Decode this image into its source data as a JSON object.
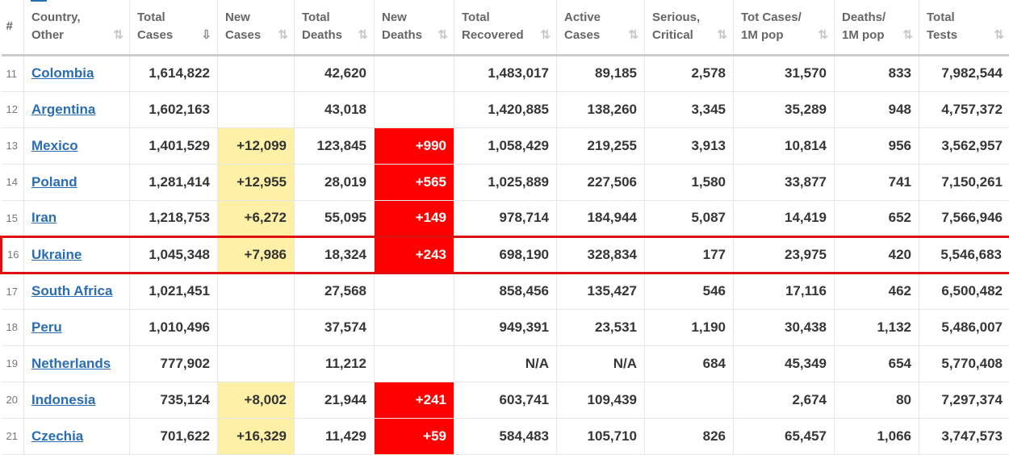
{
  "columns": [
    {
      "key": "idx",
      "label": "#",
      "sortable": false
    },
    {
      "key": "country",
      "label": "Country, Other",
      "sortable": true
    },
    {
      "key": "total_cases",
      "label": "Total Cases",
      "sortable": true,
      "active": true
    },
    {
      "key": "new_cases",
      "label": "New Cases",
      "sortable": true
    },
    {
      "key": "total_deaths",
      "label": "Total Deaths",
      "sortable": true
    },
    {
      "key": "new_deaths",
      "label": "New Deaths",
      "sortable": true
    },
    {
      "key": "total_recovered",
      "label": "Total Recovered",
      "sortable": true
    },
    {
      "key": "active_cases",
      "label": "Active Cases",
      "sortable": true
    },
    {
      "key": "serious",
      "label": "Serious, Critical",
      "sortable": true
    },
    {
      "key": "cases_per_m",
      "label": "Tot Cases/ 1M pop",
      "sortable": true
    },
    {
      "key": "deaths_per_m",
      "label": "Deaths/ 1M pop",
      "sortable": true
    },
    {
      "key": "total_tests",
      "label": "Total Tests",
      "sortable": true
    }
  ],
  "sort_icon": "⇅",
  "sort_icon_active": "⇩",
  "colors": {
    "new_cases_bg": "#fff0a8",
    "new_deaths_bg": "#ff0000",
    "highlight_border": "#e01010",
    "link": "#2a6db5"
  },
  "highlighted_country": "Ukraine",
  "rows": [
    {
      "idx": "11",
      "country": "Colombia",
      "total_cases": "1,614,822",
      "new_cases": "",
      "total_deaths": "42,620",
      "new_deaths": "",
      "total_recovered": "1,483,017",
      "active_cases": "89,185",
      "serious": "2,578",
      "cases_per_m": "31,570",
      "deaths_per_m": "833",
      "total_tests": "7,982,544"
    },
    {
      "idx": "12",
      "country": "Argentina",
      "total_cases": "1,602,163",
      "new_cases": "",
      "total_deaths": "43,018",
      "new_deaths": "",
      "total_recovered": "1,420,885",
      "active_cases": "138,260",
      "serious": "3,345",
      "cases_per_m": "35,289",
      "deaths_per_m": "948",
      "total_tests": "4,757,372"
    },
    {
      "idx": "13",
      "country": "Mexico",
      "total_cases": "1,401,529",
      "new_cases": "+12,099",
      "total_deaths": "123,845",
      "new_deaths": "+990",
      "total_recovered": "1,058,429",
      "active_cases": "219,255",
      "serious": "3,913",
      "cases_per_m": "10,814",
      "deaths_per_m": "956",
      "total_tests": "3,562,957"
    },
    {
      "idx": "14",
      "country": "Poland",
      "total_cases": "1,281,414",
      "new_cases": "+12,955",
      "total_deaths": "28,019",
      "new_deaths": "+565",
      "total_recovered": "1,025,889",
      "active_cases": "227,506",
      "serious": "1,580",
      "cases_per_m": "33,877",
      "deaths_per_m": "741",
      "total_tests": "7,150,261"
    },
    {
      "idx": "15",
      "country": "Iran",
      "total_cases": "1,218,753",
      "new_cases": "+6,272",
      "total_deaths": "55,095",
      "new_deaths": "+149",
      "total_recovered": "978,714",
      "active_cases": "184,944",
      "serious": "5,087",
      "cases_per_m": "14,419",
      "deaths_per_m": "652",
      "total_tests": "7,566,946"
    },
    {
      "idx": "16",
      "country": "Ukraine",
      "total_cases": "1,045,348",
      "new_cases": "+7,986",
      "total_deaths": "18,324",
      "new_deaths": "+243",
      "total_recovered": "698,190",
      "active_cases": "328,834",
      "serious": "177",
      "cases_per_m": "23,975",
      "deaths_per_m": "420",
      "total_tests": "5,546,683"
    },
    {
      "idx": "17",
      "country": "South Africa",
      "total_cases": "1,021,451",
      "new_cases": "",
      "total_deaths": "27,568",
      "new_deaths": "",
      "total_recovered": "858,456",
      "active_cases": "135,427",
      "serious": "546",
      "cases_per_m": "17,116",
      "deaths_per_m": "462",
      "total_tests": "6,500,482"
    },
    {
      "idx": "18",
      "country": "Peru",
      "total_cases": "1,010,496",
      "new_cases": "",
      "total_deaths": "37,574",
      "new_deaths": "",
      "total_recovered": "949,391",
      "active_cases": "23,531",
      "serious": "1,190",
      "cases_per_m": "30,438",
      "deaths_per_m": "1,132",
      "total_tests": "5,486,007"
    },
    {
      "idx": "19",
      "country": "Netherlands",
      "total_cases": "777,902",
      "new_cases": "",
      "total_deaths": "11,212",
      "new_deaths": "",
      "total_recovered": "N/A",
      "active_cases": "N/A",
      "serious": "684",
      "cases_per_m": "45,349",
      "deaths_per_m": "654",
      "total_tests": "5,770,408"
    },
    {
      "idx": "20",
      "country": "Indonesia",
      "total_cases": "735,124",
      "new_cases": "+8,002",
      "total_deaths": "21,944",
      "new_deaths": "+241",
      "total_recovered": "603,741",
      "active_cases": "109,439",
      "serious": "",
      "cases_per_m": "2,674",
      "deaths_per_m": "80",
      "total_tests": "7,297,374"
    },
    {
      "idx": "21",
      "country": "Czechia",
      "total_cases": "701,622",
      "new_cases": "+16,329",
      "total_deaths": "11,429",
      "new_deaths": "+59",
      "total_recovered": "584,483",
      "active_cases": "105,710",
      "serious": "826",
      "cases_per_m": "65,457",
      "deaths_per_m": "1,066",
      "total_tests": "3,747,573"
    }
  ]
}
